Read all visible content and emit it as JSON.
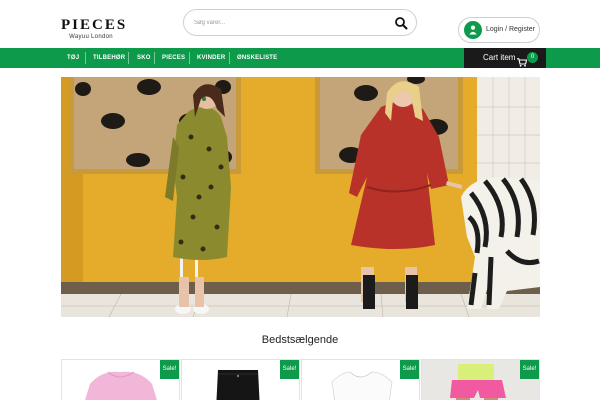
{
  "brand": {
    "name": "PIECES",
    "tagline": "Wayuu London"
  },
  "search": {
    "placeholder": "Søg varer..."
  },
  "account": {
    "label": "Login / Register"
  },
  "nav": {
    "items": [
      {
        "label": "TØJ"
      },
      {
        "label": "TILBEHØR"
      },
      {
        "label": "SKO"
      },
      {
        "label": "PIECES"
      },
      {
        "label": "KVINDER"
      },
      {
        "label": "ØNSKELISTE"
      }
    ]
  },
  "cart": {
    "label": "Cart item",
    "count": "0"
  },
  "bestsellers": {
    "title": "Bedstsælgende",
    "products": [
      {
        "badge": "Sale!",
        "icon": "pink-sweater-image"
      },
      {
        "badge": "Sale!",
        "icon": "black-jeans-image"
      },
      {
        "badge": "Sale!",
        "icon": "white-top-image"
      },
      {
        "badge": "Sale!",
        "icon": "pink-shorts-image"
      }
    ]
  },
  "colors": {
    "brand_green": "#0d9a4b",
    "cart_bg": "#1a1a1a",
    "hero_wall": "#e5ac2b"
  }
}
